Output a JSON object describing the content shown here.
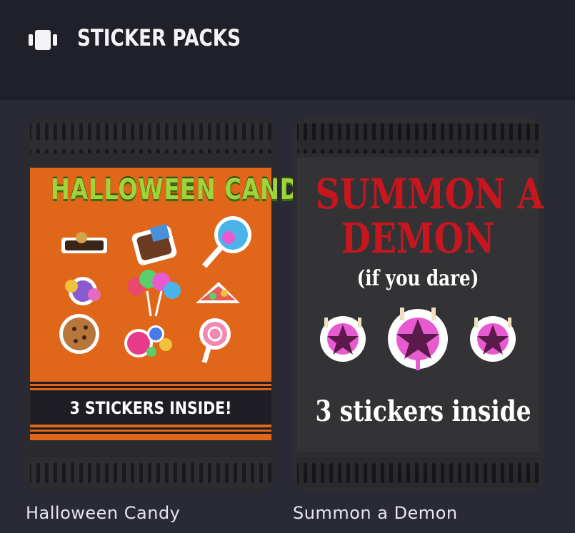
{
  "header": {
    "title": "STICKER PACKS",
    "icon": "sticker-packs-icon"
  },
  "packs": [
    {
      "name": "Halloween Candy",
      "art_title": "HALLOWEEN CANDY",
      "art_tagline": "3 STICKERS INSIDE!",
      "colors": {
        "body": "#e0661a",
        "title": "#9fd43a",
        "band": "#1e1e24"
      },
      "stickers": [
        "chocolate-bar-icon",
        "candy-chunk-icon",
        "lollipop-icon",
        "wrapped-candy-icon",
        "lollipop-bouquet-icon",
        "candy-pile-icon",
        "cookie-icon",
        "gumballs-icon",
        "swirl-lollipop-icon"
      ]
    },
    {
      "name": "Summon a Demon",
      "art_title_line1": "SUMMON A",
      "art_title_line2": "DEMON",
      "art_subtitle": "(if you dare)",
      "art_tagline": "3 stickers inside",
      "colors": {
        "body": "#2b2b2e",
        "title": "#c8161e"
      },
      "stickers": [
        "pentagram-candles-icon",
        "pentagram-candles-icon",
        "pentagram-candles-icon"
      ]
    }
  ]
}
